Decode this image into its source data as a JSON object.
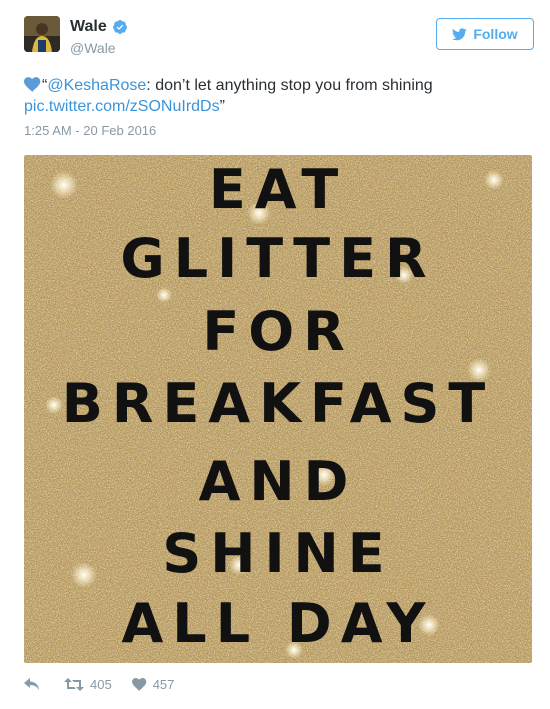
{
  "user": {
    "display_name": "Wale",
    "handle": "@Wale",
    "verified_icon": "verified-badge-icon",
    "avatar_icon": "avatar"
  },
  "follow_button": {
    "label": "Follow",
    "icon": "twitter-bird-icon"
  },
  "tweet": {
    "quote_open": "“",
    "mention": "@KeshaRose",
    "body": ": don’t let anything stop you from shining",
    "link": "pic.twitter.com/zSONuIrdDs",
    "quote_close": "”",
    "timestamp": "1:25 AM - 20 Feb 2016"
  },
  "media": {
    "lines": [
      "EAT",
      "GLITTER",
      "FOR",
      "BREAKFAST",
      "AND",
      "SHINE",
      "ALL DAY"
    ]
  },
  "actions": {
    "reply_icon": "reply-icon",
    "retweet_icon": "retweet-icon",
    "retweet_count": "405",
    "like_icon": "heart-icon",
    "like_count": "457"
  },
  "colors": {
    "accent": "#55acee",
    "link": "#3b94d9",
    "muted": "#8899a6",
    "glitter_base": "#b89a5c"
  }
}
